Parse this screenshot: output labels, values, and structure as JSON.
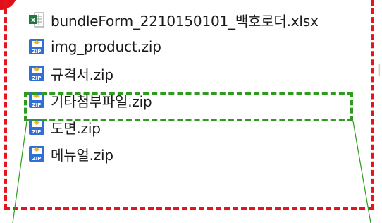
{
  "files": [
    {
      "name": "bundleForm_2210150101_백호로더.xlsx",
      "icon": "excel-file-icon"
    },
    {
      "name": "img_product.zip",
      "icon": "zip-archive-icon"
    },
    {
      "name": "규격서.zip",
      "icon": "zip-archive-icon"
    },
    {
      "name": "기타첨부파일.zip",
      "icon": "zip-archive-icon"
    },
    {
      "name": "도면.zip",
      "icon": "zip-archive-icon"
    },
    {
      "name": "메뉴얼.zip",
      "icon": "zip-archive-icon"
    }
  ],
  "colors": {
    "annotation_red": "#e8141c",
    "annotation_green": "#2e9a1e",
    "zip_blue": "#2f6fd6",
    "excel_green": "#1d7a3e"
  }
}
